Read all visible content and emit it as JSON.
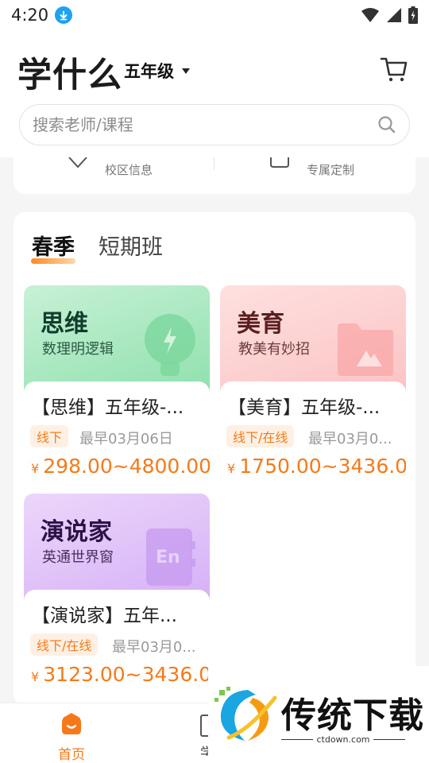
{
  "status_bar": {
    "time": "4:20"
  },
  "header": {
    "logo": "学什么",
    "grade": "五年级",
    "search_placeholder": "搜索老师/课程"
  },
  "quick_links": [
    "校区信息",
    "专属定制"
  ],
  "tabs": [
    "春季",
    "短期班"
  ],
  "courses": [
    {
      "banner_title": "思维",
      "banner_subtitle": "数理明逻辑",
      "title": "【思维】五年级-...",
      "tag": "线下",
      "date": "最早03月06日",
      "price_symbol": "¥",
      "price": "298.00~4800.00"
    },
    {
      "banner_title": "美育",
      "banner_subtitle": "教美有妙招",
      "title": "【美育】五年级-...",
      "tag": "线下/在线",
      "date": "最早03月0...",
      "price_symbol": "¥",
      "price": "1750.00~3436.0"
    },
    {
      "banner_title": "演说家",
      "banner_subtitle": "英通世界窗",
      "title": "【演说家】五年...",
      "tag": "线下/在线",
      "date": "最早03月0...",
      "price_symbol": "¥",
      "price": "3123.00~3436.0"
    }
  ],
  "bottom_nav": {
    "home_label": "首页",
    "second_label": "学"
  },
  "watermark": {
    "brand": "传统下载",
    "url": "ctdown.com"
  },
  "colors": {
    "accent": "#f5791b",
    "price": "#f47a1a"
  }
}
